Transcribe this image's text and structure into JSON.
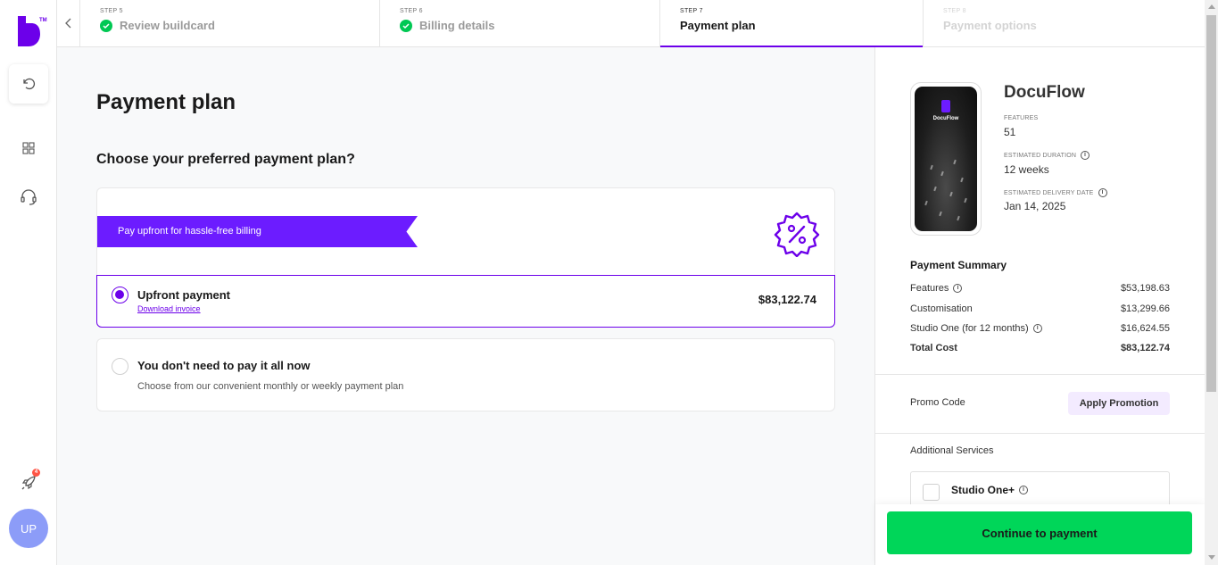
{
  "logo": {
    "tm": "TM"
  },
  "stepper": {
    "steps": [
      {
        "number": "STEP 5",
        "label": "Review buildcard",
        "state": "complete"
      },
      {
        "number": "STEP 6",
        "label": "Billing details",
        "state": "complete"
      },
      {
        "number": "STEP 7",
        "label": "Payment plan",
        "state": "active"
      },
      {
        "number": "STEP 8",
        "label": "Payment options",
        "state": "disabled"
      }
    ]
  },
  "sidebar": {
    "notification_count": "4",
    "avatar_initials": "UP"
  },
  "main": {
    "title": "Payment plan",
    "subtitle": "Choose your preferred payment plan?",
    "ribbon_text": "Pay upfront for hassle-free billing",
    "options": [
      {
        "title": "Upfront payment",
        "link": "Download invoice",
        "price": "$83,122.74",
        "selected": true
      },
      {
        "title": "You don't need to pay it all now",
        "description": "Choose from our convenient monthly or weekly payment plan",
        "selected": false
      }
    ]
  },
  "panel": {
    "app_name": "DocuFlow",
    "phone_name": "DocuFlow",
    "features_label": "FEATURES",
    "features_value": "51",
    "duration_label": "ESTIMATED DURATION",
    "duration_value": "12 weeks",
    "delivery_label": "ESTIMATED DELIVERY DATE",
    "delivery_value": "Jan 14, 2025",
    "summary_title": "Payment Summary",
    "summary": [
      {
        "label": "Features",
        "value": "$53,198.63"
      },
      {
        "label": "Customisation",
        "value": "$13,299.66"
      },
      {
        "label": "Studio One (for 12 months)",
        "value": "$16,624.55"
      },
      {
        "label": "Total Cost",
        "value": "$83,122.74"
      }
    ],
    "promo_label": "Promo Code",
    "promo_button": "Apply Promotion",
    "additional_title": "Additional Services",
    "additional_item": "Studio One+",
    "cta": "Continue to payment"
  },
  "colors": {
    "brand": "#6c00ea",
    "success": "#00c853",
    "cta": "#00d659"
  },
  "icons": [
    "builder-logo",
    "undo-icon",
    "dashboard-icon",
    "headset-icon",
    "rocket-icon",
    "chevron-left-icon",
    "check-icon",
    "discount-badge-icon",
    "info-icon"
  ]
}
